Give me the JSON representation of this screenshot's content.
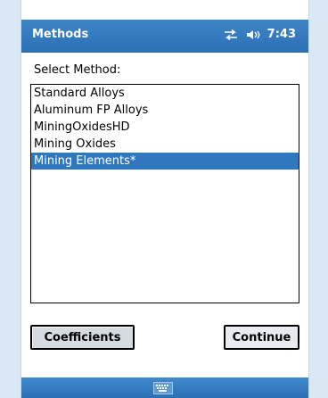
{
  "titlebar": {
    "title": "Methods",
    "time": "7:43",
    "icons": [
      "sync-icon",
      "speaker-icon"
    ]
  },
  "form": {
    "label": "Select Method:",
    "methods": [
      "Standard Alloys",
      "Aluminum FP Alloys",
      "MiningOxidesHD",
      "Mining Oxides",
      "Mining Elements*"
    ],
    "selected_index": 4
  },
  "buttons": {
    "coefficients": "Coefficients",
    "continue": "Continue"
  },
  "softbar": {
    "icon": "keyboard-icon"
  },
  "colors": {
    "titlebar": "#2f78bf",
    "selection": "#2f78bf",
    "button_face": "#d6dbe2"
  }
}
